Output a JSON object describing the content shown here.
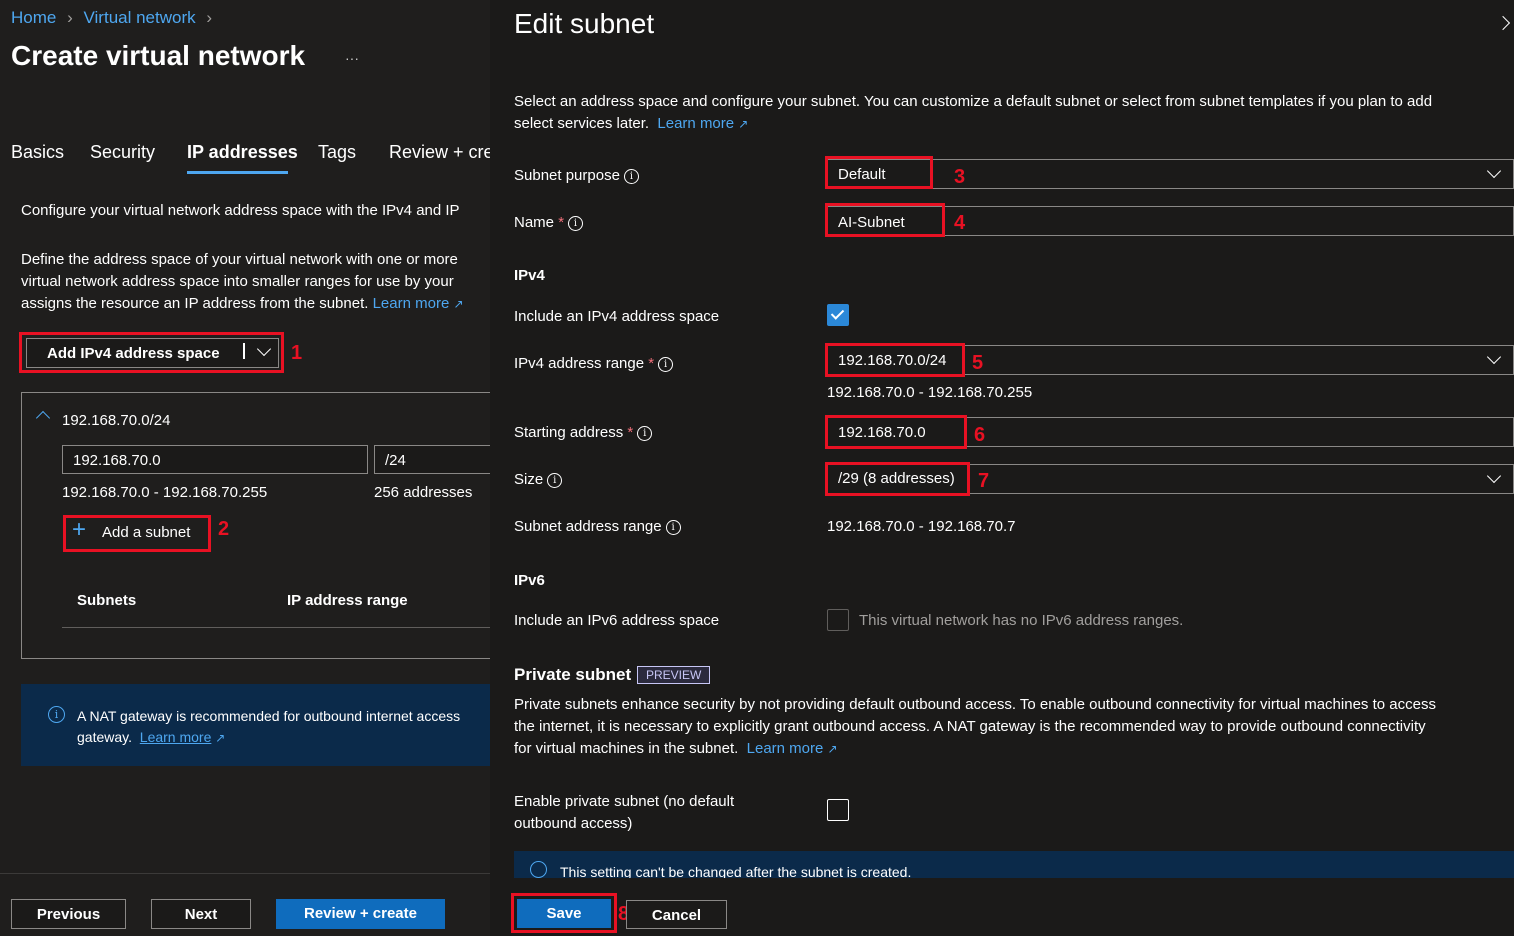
{
  "breadcrumb": {
    "home": "Home",
    "virtual_network": "Virtual network"
  },
  "page_title": "Create virtual network",
  "more": "···",
  "tabs": [
    "Basics",
    "Security",
    "IP addresses",
    "Tags",
    "Review + cre"
  ],
  "left": {
    "desc1": "Configure your virtual network address space with the IPv4 and IP",
    "desc2_lines": [
      "Define the address space of your virtual network with one or more",
      "virtual network address space into smaller ranges for use by your",
      "assigns the resource an IP address from the subnet."
    ],
    "learn_more": "Learn more",
    "add_ipv4_label": "Add IPv4 address space",
    "address_space": "192.168.70.0/24",
    "start_input": "192.168.70.0",
    "prefix_input": "/24",
    "range_text": "192.168.70.0 - 192.168.70.255",
    "count_text": "256 addresses",
    "add_subnet": "Add a subnet",
    "col_subnets": "Subnets",
    "col_ip_range": "IP address range",
    "nat_line1": "A NAT gateway is recommended for outbound internet access",
    "nat_line2": "gateway.",
    "nat_learn": "Learn more"
  },
  "footer": {
    "previous": "Previous",
    "next": "Next",
    "review": "Review + create"
  },
  "panel": {
    "title": "Edit subnet",
    "intro_line1": "Select an address space and configure your subnet. You can customize a default subnet or select from subnet templates if you plan to add",
    "intro_line2": "select services later.",
    "learn_more": "Learn more",
    "subnet_purpose_label": "Subnet purpose",
    "subnet_purpose_value": "Default",
    "name_label": "Name",
    "name_value": "AI-Subnet",
    "ipv4_heading": "IPv4",
    "include_ipv4_label": "Include an IPv4 address space",
    "ipv4_range_label": "IPv4 address range",
    "ipv4_range_value": "192.168.70.0/24",
    "ipv4_range_hint": "192.168.70.0 - 192.168.70.255",
    "starting_label": "Starting address",
    "starting_value": "192.168.70.0",
    "size_label": "Size",
    "size_value": "/29 (8 addresses)",
    "subnet_range_label": "Subnet address range",
    "subnet_range_value": "192.168.70.0 - 192.168.70.7",
    "ipv6_heading": "IPv6",
    "include_ipv6_label": "Include an IPv6 address space",
    "ipv6_note": "This virtual network has no IPv6 address ranges.",
    "private_heading": "Private subnet",
    "preview_badge": "PREVIEW",
    "private_lines": [
      "Private subnets enhance security by not providing default outbound access. To enable outbound connectivity for virtual machines to access",
      "the internet, it is necessary to explicitly grant outbound access. A NAT gateway is the recommended way to provide outbound connectivity",
      "for virtual machines in the subnet."
    ],
    "private_learn": "Learn more",
    "enable_private_line1": "Enable private subnet (no default",
    "enable_private_line2": "outbound access)",
    "info_bar": "This setting can't be changed after the subnet is created.",
    "save": "Save",
    "cancel": "Cancel"
  },
  "annotations": [
    "1",
    "2",
    "3",
    "4",
    "5",
    "6",
    "7",
    "8"
  ],
  "colors": {
    "accent": "#0f6cbd",
    "link": "#4ea7f0",
    "annotation": "#e81123",
    "info_bar": "#0b2a4a"
  }
}
